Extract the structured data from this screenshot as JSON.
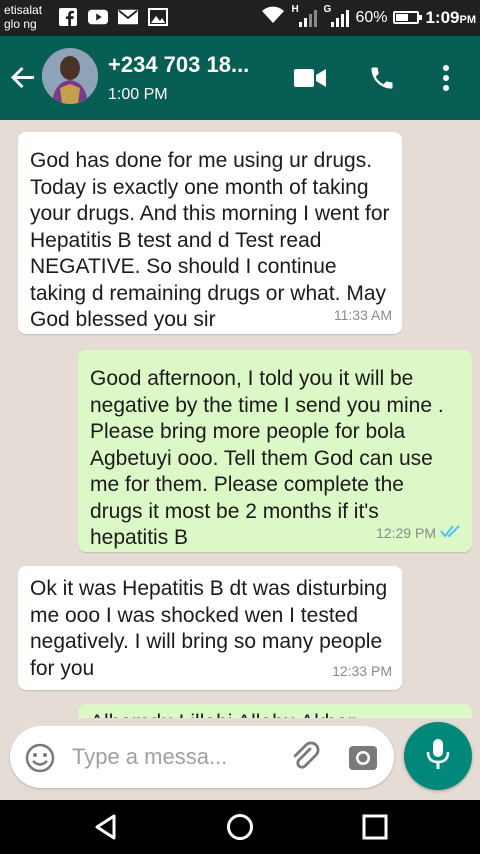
{
  "status_bar": {
    "carrier_line1": "etisalat",
    "carrier_line2": "glo ng",
    "icons": [
      "facebook-icon",
      "youtube-icon",
      "mail-icon",
      "gallery-icon",
      "wifi-icon",
      "signal-h-icon",
      "signal-g-icon"
    ],
    "signal_h": "H",
    "signal_g": "G",
    "battery_percent": "60%",
    "battery_level": 0.6,
    "time": "1:09",
    "time_suffix": "PM"
  },
  "header": {
    "contact_name": "+234 703 18...",
    "last_seen": "1:00 PM",
    "bg_color": "#075e54"
  },
  "messages": [
    {
      "direction": "in",
      "text": "God has done for me using ur drugs. Today is exactly one month of taking your drugs. And this morning I went for Hepatitis B test and d Test read NEGATIVE. So should I continue taking d remaining drugs or what. May God blessed you sir",
      "time": "11:33 AM"
    },
    {
      "direction": "out",
      "text": "Good afternoon, I told you it will be negative by the time I send you mine . Please bring more people for bola Agbetuyi ooo. Tell them God can use me for them. Please complete the drugs it most be 2 months if it's hepatitis B",
      "time": "12:29 PM",
      "status": "read"
    },
    {
      "direction": "in",
      "text": "Ok it was Hepatitis B dt was disturbing me ooo I was shocked wen I tested negatively. I will bring so many people for you",
      "time": "12:33 PM"
    },
    {
      "direction": "out",
      "text": "Alhamdu Lillahi Allahu Akbar",
      "time": ""
    }
  ],
  "composer": {
    "placeholder": "Type a messa..."
  },
  "colors": {
    "incoming_bubble": "#ffffff",
    "outgoing_bubble": "#dcf8c6",
    "accent": "#00897b",
    "read_tick": "#4fc3f7"
  }
}
